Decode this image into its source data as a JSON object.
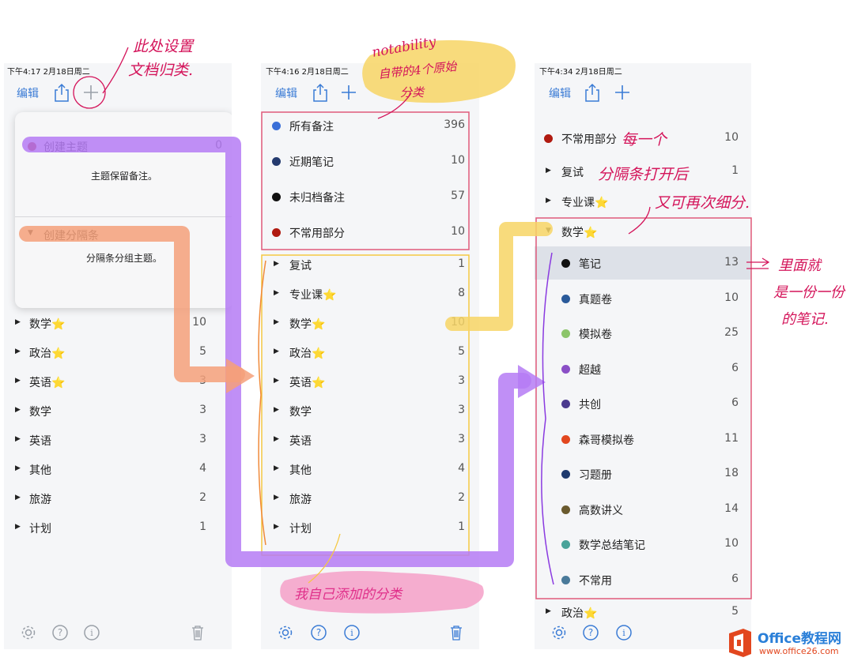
{
  "colors": {
    "accent": "#3a7bd5",
    "annotation": "#d4145a",
    "purple": "#b57bf5",
    "orange": "#f5a07a",
    "yellow": "#f7d565",
    "frame": "#e05a7a"
  },
  "left": {
    "status": "下午4:17  2月18日周二",
    "edit": "编辑",
    "popup": {
      "create_topic": "创建主题",
      "create_topic_count": "0",
      "topic_desc": "主题保留备注。",
      "create_divider": "创建分隔条",
      "divider_desc": "分隔条分组主题。"
    },
    "items": [
      {
        "label": "数学⭐",
        "count": "10"
      },
      {
        "label": "政治⭐",
        "count": "5"
      },
      {
        "label": "英语⭐",
        "count": "3"
      },
      {
        "label": "数学",
        "count": "3"
      },
      {
        "label": "英语",
        "count": "3"
      },
      {
        "label": "其他",
        "count": "4"
      },
      {
        "label": "旅游",
        "count": "2"
      },
      {
        "label": "计划",
        "count": "1"
      }
    ]
  },
  "middle": {
    "status": "下午4:16  2月18日周二",
    "edit": "编辑",
    "fixed": [
      {
        "label": "所有备注",
        "count": "396",
        "color": "#3a6fd8"
      },
      {
        "label": "近期笔记",
        "count": "10",
        "color": "#243a6e"
      },
      {
        "label": "未归档备注",
        "count": "57",
        "color": "#111111"
      },
      {
        "label": "不常用部分",
        "count": "10",
        "color": "#b01a10"
      }
    ],
    "items": [
      {
        "label": "复试",
        "count": "1"
      },
      {
        "label": "专业课⭐",
        "count": "8"
      },
      {
        "label": "数学⭐",
        "count": "10"
      },
      {
        "label": "政治⭐",
        "count": "5"
      },
      {
        "label": "英语⭐",
        "count": "3"
      },
      {
        "label": "数学",
        "count": "3"
      },
      {
        "label": "英语",
        "count": "3"
      },
      {
        "label": "其他",
        "count": "4"
      },
      {
        "label": "旅游",
        "count": "2"
      },
      {
        "label": "计划",
        "count": "1"
      }
    ]
  },
  "right": {
    "status": "下午4:34  2月18日周二",
    "edit": "编辑",
    "top_item": {
      "label": "不常用部分",
      "count": "10",
      "color": "#b01a10"
    },
    "dividers": [
      {
        "label": "复试",
        "count": "1"
      },
      {
        "label": "专业课⭐",
        "count": ""
      }
    ],
    "open_divider": {
      "label": "数学⭐"
    },
    "subitems": [
      {
        "label": "笔记",
        "count": "13",
        "color": "#111111"
      },
      {
        "label": "真题卷",
        "count": "10",
        "color": "#2a5a9a"
      },
      {
        "label": "模拟卷",
        "count": "25",
        "color": "#8cc56a"
      },
      {
        "label": "超越",
        "count": "6",
        "color": "#8a4fc6"
      },
      {
        "label": "共创",
        "count": "6",
        "color": "#4b3a8e"
      },
      {
        "label": "森哥模拟卷",
        "count": "11",
        "color": "#e2471f"
      },
      {
        "label": "习题册",
        "count": "18",
        "color": "#1f3a6e"
      },
      {
        "label": "高数讲义",
        "count": "14",
        "color": "#6a5a2e"
      },
      {
        "label": "数学总结笔记",
        "count": "10",
        "color": "#4aa39a"
      },
      {
        "label": "不常用",
        "count": "6",
        "color": "#4a7a9a"
      }
    ],
    "bottom_item": {
      "label": "政治⭐",
      "count": "5"
    }
  },
  "annotations": {
    "plus_note_1": "此处设置",
    "plus_note_2": "文档归类.",
    "notability_1": "notability",
    "notability_2": "自带的4个原始",
    "notability_3": "分类",
    "divider_note_1": "每一个",
    "divider_note_2": "分隔条打开后",
    "divider_note_3": "又可再次细分.",
    "notes_note_1": "里面就",
    "notes_note_2": "是一份一份",
    "notes_note_3": "的笔记.",
    "custom_note": "我自己添加的分类"
  },
  "logo": {
    "title": "Office教程网",
    "url": "www.office26.com"
  }
}
